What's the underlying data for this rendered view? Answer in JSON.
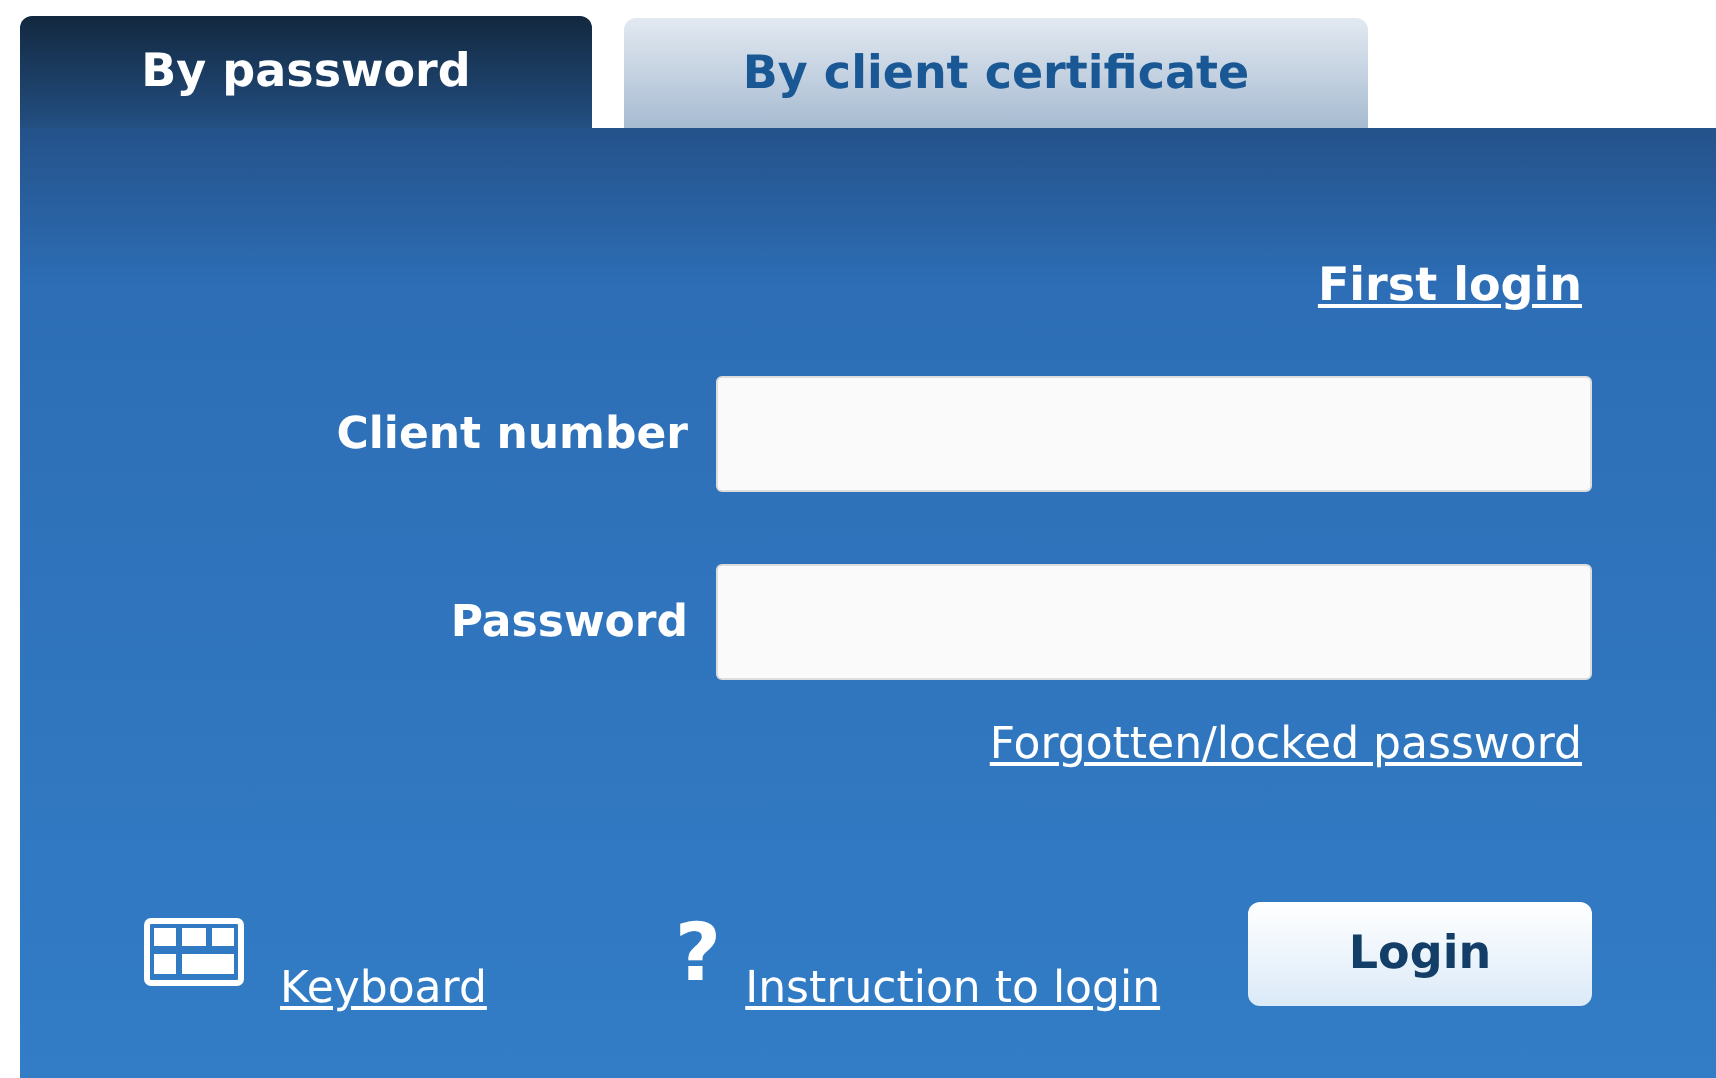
{
  "tabs": [
    {
      "label": "By password",
      "selected": true
    },
    {
      "label": "By client certificate",
      "selected": false
    }
  ],
  "first_login_link": "First login",
  "fields": [
    {
      "label": "Client number"
    },
    {
      "label": "Password"
    }
  ],
  "forgotten_link": "Forgotten/locked password",
  "keyboard_link": "Keyboard",
  "help": {
    "glyph": "?",
    "link": "Instruction to login"
  },
  "login_button": "Login"
}
